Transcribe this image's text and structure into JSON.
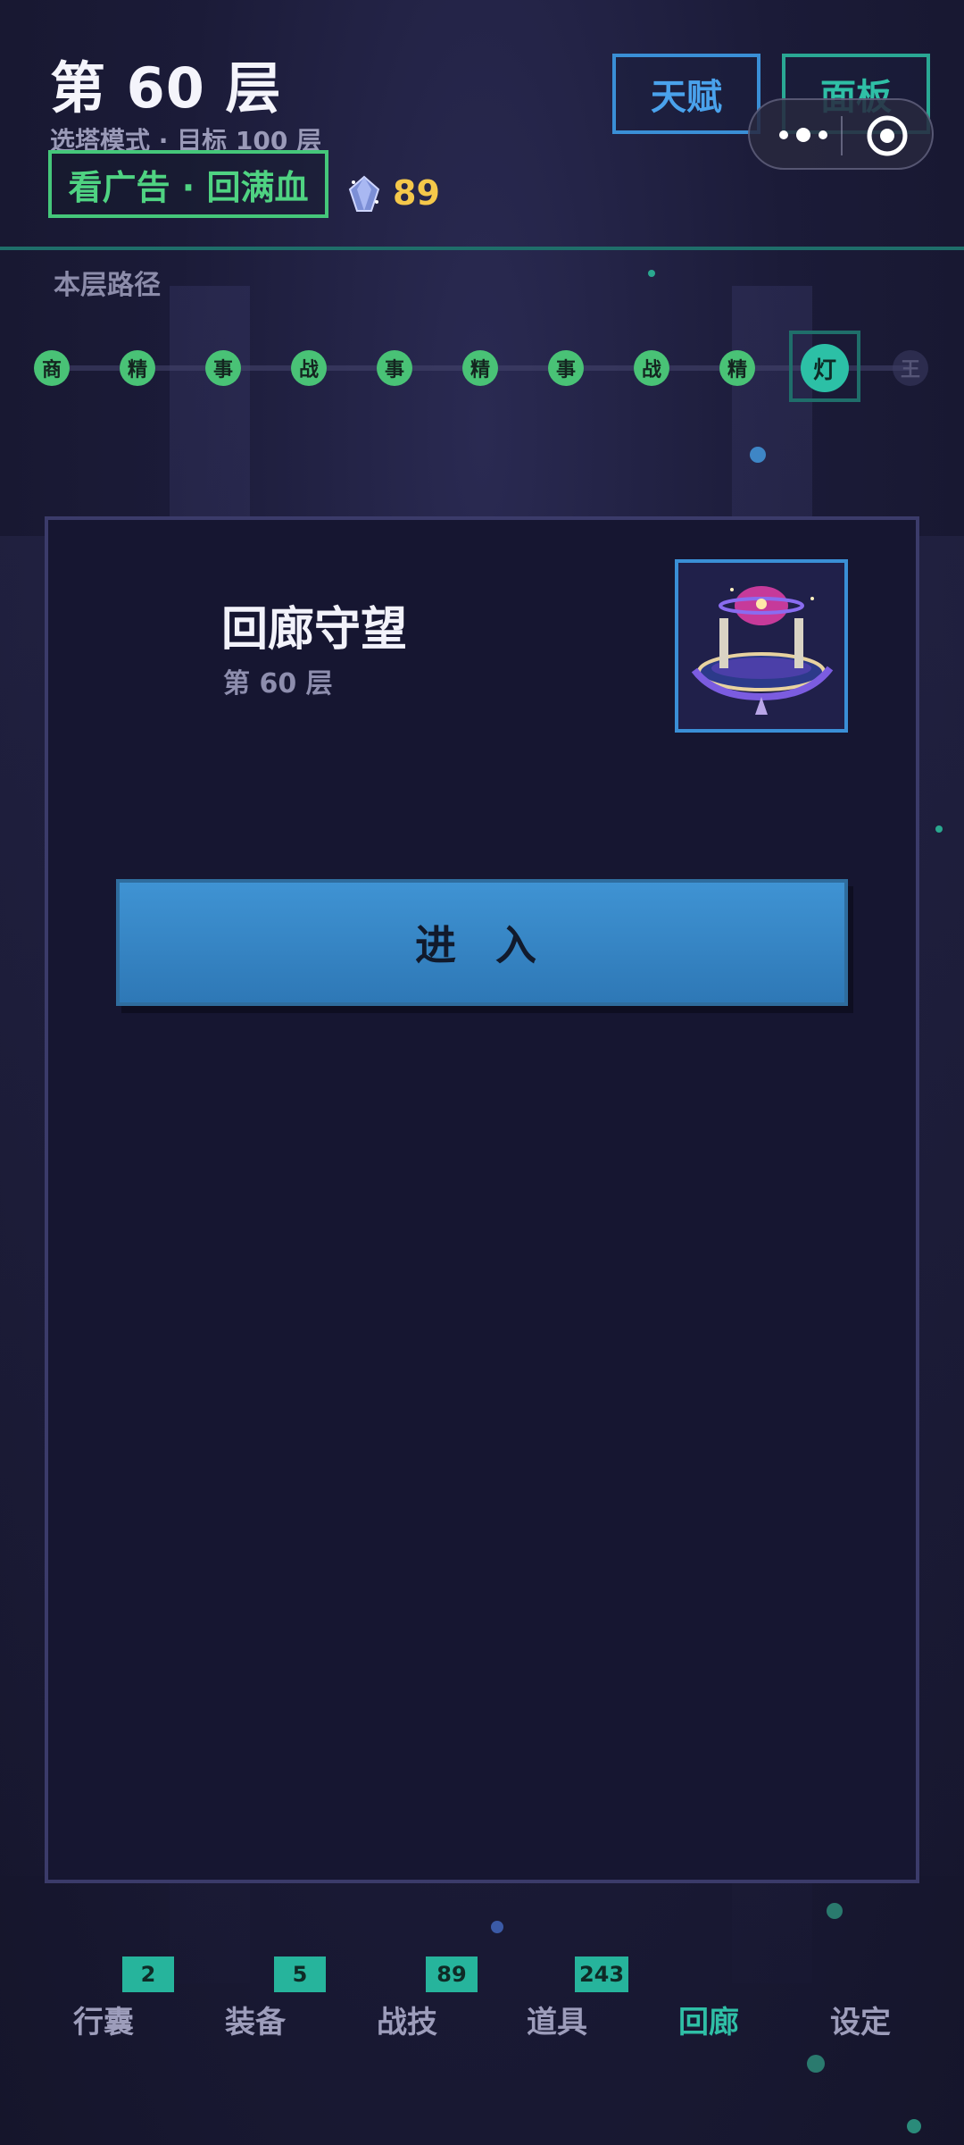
{
  "header": {
    "floor_title": "第 60 层",
    "mode_text": "选塔模式 · 目标 100 层",
    "ad_button": "看广告 · 回满血",
    "gem_count": "89",
    "talent_button": "天赋",
    "panel_button": "面板"
  },
  "path": {
    "label": "本层路径",
    "nodes": [
      "商",
      "精",
      "事",
      "战",
      "事",
      "精",
      "事",
      "战",
      "精",
      "灯",
      "王"
    ],
    "current_index": 9
  },
  "card": {
    "title": "回廊守望",
    "subtitle": "第 60 层",
    "enter_button": "进 入"
  },
  "bottom_nav": {
    "items": [
      {
        "label": "行囊",
        "badge": "2"
      },
      {
        "label": "装备",
        "badge": "5"
      },
      {
        "label": "战技",
        "badge": "89"
      },
      {
        "label": "道具",
        "badge": "243"
      },
      {
        "label": "回廊",
        "badge": ""
      },
      {
        "label": "设定",
        "badge": ""
      }
    ],
    "active_index": 4
  },
  "colors": {
    "accent_green": "#45c77a",
    "accent_teal": "#2fbfa6",
    "accent_blue": "#3a8fd6",
    "gem_gold": "#f5c84a"
  }
}
